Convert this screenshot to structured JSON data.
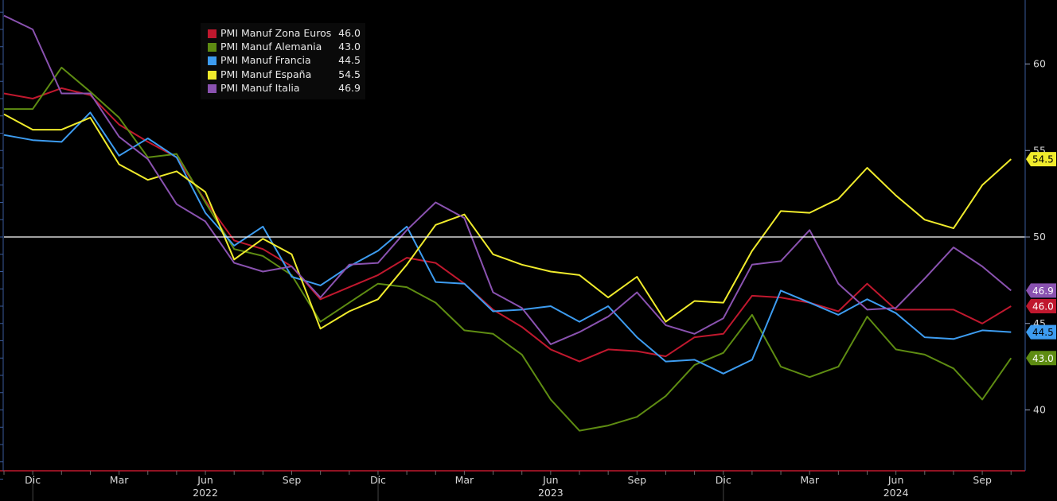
{
  "chart_data": {
    "type": "line",
    "title": "",
    "xlabel": "",
    "ylabel": "",
    "ylim": [
      35,
      63.5
    ],
    "y_ticks": [
      40,
      45,
      50,
      55,
      60
    ],
    "y_tick_labels": [
      "40",
      "45",
      "50",
      "55",
      "60"
    ],
    "reference_line": 50,
    "grid": false,
    "legend_position": "top-left",
    "x_tick_labels": [
      "Dic",
      "Mar",
      "Jun",
      "Sep",
      "Dic",
      "Mar",
      "Jun",
      "Sep",
      "Dic",
      "Mar",
      "Jun",
      "Sep"
    ],
    "x_tick_months": [
      1,
      4,
      7,
      10,
      13,
      16,
      19,
      22,
      25,
      28,
      31,
      34
    ],
    "year_labels": [
      {
        "label": "2022",
        "month": 7
      },
      {
        "label": "2023",
        "month": 19
      },
      {
        "label": "2024",
        "month": 31
      }
    ],
    "series": [
      {
        "name": "PMI Manuf Zona Euros",
        "last": "46.0",
        "color": "#c0182e",
        "x": [
          0,
          1,
          2,
          3,
          4,
          5,
          6,
          7,
          8,
          9,
          10,
          11,
          12,
          13,
          14,
          15,
          16,
          17,
          18,
          19,
          20,
          21,
          22,
          23,
          24,
          25,
          26,
          27,
          28,
          29,
          30,
          31,
          32,
          33,
          34,
          35
        ],
        "values": [
          58.3,
          58.0,
          58.6,
          58.2,
          56.5,
          55.5,
          54.6,
          52.1,
          49.8,
          49.3,
          48.3,
          46.4,
          47.1,
          47.8,
          48.8,
          48.5,
          47.3,
          45.8,
          44.8,
          43.5,
          42.8,
          43.5,
          43.4,
          43.1,
          44.2,
          44.4,
          46.6,
          46.5,
          46.2,
          45.7,
          47.3,
          45.8,
          45.8,
          45.8,
          45.0,
          46.0
        ]
      },
      {
        "name": "PMI Manuf Alemania",
        "last": "43.0",
        "color": "#5e8c12",
        "x": [
          0,
          1,
          2,
          3,
          4,
          5,
          6,
          7,
          8,
          9,
          10,
          11,
          12,
          13,
          14,
          15,
          16,
          17,
          18,
          19,
          20,
          21,
          22,
          23,
          24,
          25,
          26,
          27,
          28,
          29,
          30,
          31,
          32,
          33,
          34,
          35
        ],
        "values": [
          57.4,
          57.4,
          59.8,
          58.4,
          56.9,
          54.6,
          54.8,
          52.0,
          49.3,
          48.9,
          47.8,
          45.1,
          46.2,
          47.3,
          47.1,
          46.2,
          44.6,
          44.4,
          43.2,
          40.6,
          38.8,
          39.1,
          39.6,
          40.8,
          42.6,
          43.3,
          45.5,
          42.5,
          41.9,
          42.5,
          45.4,
          43.5,
          43.2,
          42.4,
          40.6,
          43.0
        ]
      },
      {
        "name": "PMI Manuf Francia",
        "last": "44.5",
        "color": "#3d9cf0",
        "x": [
          0,
          1,
          2,
          3,
          4,
          5,
          6,
          7,
          8,
          9,
          10,
          11,
          12,
          13,
          14,
          15,
          16,
          17,
          18,
          19,
          20,
          21,
          22,
          23,
          24,
          25,
          26,
          27,
          28,
          29,
          30,
          31,
          32,
          33,
          34,
          35
        ],
        "values": [
          55.9,
          55.6,
          55.5,
          57.2,
          54.7,
          55.7,
          54.6,
          51.4,
          49.5,
          50.6,
          47.7,
          47.2,
          48.3,
          49.2,
          50.6,
          47.4,
          47.3,
          45.7,
          45.8,
          46.0,
          45.1,
          46.0,
          44.2,
          42.8,
          42.9,
          42.1,
          42.9,
          46.9,
          46.2,
          45.5,
          46.4,
          45.6,
          44.2,
          44.1,
          44.6,
          44.5
        ]
      },
      {
        "name": "PMI Manuf España",
        "last": "54.5",
        "color": "#f0eb2c",
        "x": [
          0,
          1,
          2,
          3,
          4,
          5,
          6,
          7,
          8,
          9,
          10,
          11,
          12,
          13,
          14,
          15,
          16,
          17,
          18,
          19,
          20,
          21,
          22,
          23,
          24,
          25,
          26,
          27,
          28,
          29,
          30,
          31,
          32,
          33,
          34,
          35
        ],
        "values": [
          57.1,
          56.2,
          56.2,
          56.9,
          54.2,
          53.3,
          53.8,
          52.6,
          48.7,
          49.9,
          49.0,
          44.7,
          45.7,
          46.4,
          48.4,
          50.7,
          51.3,
          49.0,
          48.4,
          48.0,
          47.8,
          46.5,
          47.7,
          45.1,
          46.3,
          46.2,
          49.2,
          51.5,
          51.4,
          52.2,
          54.0,
          52.4,
          51.0,
          50.5,
          53.0,
          54.5
        ]
      },
      {
        "name": "PMI Manuf Italia",
        "last": "46.9",
        "color": "#8a52b0",
        "x": [
          0,
          1,
          2,
          3,
          4,
          5,
          6,
          7,
          8,
          9,
          10,
          11,
          12,
          13,
          14,
          15,
          16,
          17,
          18,
          19,
          20,
          21,
          22,
          23,
          24,
          25,
          26,
          27,
          28,
          29,
          30,
          31,
          32,
          33,
          34,
          35
        ],
        "values": [
          62.8,
          62.0,
          58.3,
          58.3,
          55.8,
          54.5,
          51.9,
          50.9,
          48.5,
          48.0,
          48.3,
          46.5,
          48.4,
          48.5,
          50.4,
          52.0,
          51.1,
          46.8,
          45.9,
          43.8,
          44.5,
          45.4,
          46.8,
          44.9,
          44.4,
          45.3,
          48.4,
          48.6,
          50.4,
          47.3,
          45.8,
          45.9,
          47.6,
          49.4,
          48.3,
          46.9
        ]
      }
    ]
  }
}
